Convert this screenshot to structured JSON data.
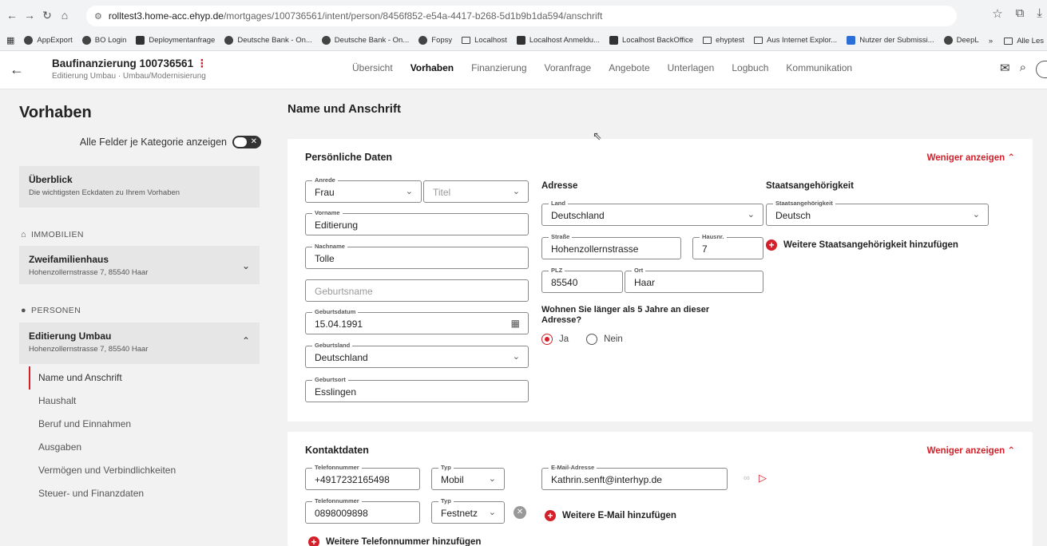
{
  "browser": {
    "url_host": "rolltest3.home-acc.ehyp.de",
    "url_path": "/mortgages/100736561/intent/person/8456f852-e54a-4417-b268-5d1b9b1da594/anschrift",
    "bookmarks": [
      "AppExport",
      "BO Login",
      "Deploymentanfrage",
      "Deutsche Bank - On...",
      "Deutsche Bank - On...",
      "Fopsy",
      "Localhost",
      "Localhost Anmeldu...",
      "Localhost BackOffice",
      "ehyptest",
      "Aus Internet Explor...",
      "Nutzer der Submissi...",
      "DeepL"
    ],
    "bookmarks_more": "»",
    "bookmarks_all": "Alle Les"
  },
  "header": {
    "title": "Baufinanzierung 100736561",
    "subtitle": "Editierung Umbau · Umbau/Modernisierung",
    "tabs": [
      "Übersicht",
      "Vorhaben",
      "Finanzierung",
      "Voranfrage",
      "Angebote",
      "Unterlagen",
      "Logbuch",
      "Kommunikation"
    ],
    "active_tab": "Vorhaben"
  },
  "sidebar": {
    "title": "Vorhaben",
    "toggle_label": "Alle Felder je Kategorie anzeigen",
    "overview": {
      "title": "Überblick",
      "subtitle": "Die wichtigsten Eckdaten zu Ihrem Vorhaben"
    },
    "immobilien_label": "IMMOBILIEN",
    "property": {
      "title": "Zweifamilienhaus",
      "subtitle": "Hohenzollernstrasse 7, 85540 Haar"
    },
    "personen_label": "PERSONEN",
    "person": {
      "title": "Editierung Umbau",
      "subtitle": "Hohenzollernstrasse 7, 85540 Haar"
    },
    "sub_items": [
      "Name und Anschrift",
      "Haushalt",
      "Beruf und Einnahmen",
      "Ausgaben",
      "Vermögen und Verbindlichkeiten",
      "Steuer- und Finanzdaten"
    ]
  },
  "main": {
    "page_title": "Name und Anschrift",
    "personal": {
      "title": "Persönliche Daten",
      "less": "Weniger anzeigen",
      "anrede": {
        "label": "Anrede",
        "value": "Frau"
      },
      "titel": {
        "placeholder": "Titel"
      },
      "vorname": {
        "label": "Vorname",
        "value": "Editierung"
      },
      "nachname": {
        "label": "Nachname",
        "value": "Tolle"
      },
      "geburtsname": {
        "placeholder": "Geburtsname"
      },
      "geburtsdatum": {
        "label": "Geburtsdatum",
        "value": "15.04.1991"
      },
      "geburtsland": {
        "label": "Geburtsland",
        "value": "Deutschland"
      },
      "geburtsort": {
        "label": "Geburtsort",
        "value": "Esslingen"
      }
    },
    "address": {
      "heading": "Adresse",
      "land": {
        "label": "Land",
        "value": "Deutschland"
      },
      "strasse": {
        "label": "Straße",
        "value": "Hohenzollernstrasse"
      },
      "hausnr": {
        "label": "Hausnr.",
        "value": "7"
      },
      "plz": {
        "label": "PLZ",
        "value": "85540"
      },
      "ort": {
        "label": "Ort",
        "value": "Haar"
      },
      "question": "Wohnen Sie länger als 5 Jahre an dieser Adresse?",
      "yes": "Ja",
      "no": "Nein"
    },
    "nationality": {
      "heading": "Staatsangehörigkeit",
      "field": {
        "label": "Staatsangehörigkeit",
        "value": "Deutsch"
      },
      "add": "Weitere Staatsangehörigkeit hinzufügen"
    },
    "contact": {
      "title": "Kontaktdaten",
      "less": "Weniger anzeigen",
      "phone1": {
        "label": "Telefonnummer",
        "value": "+4917232165498"
      },
      "type1": {
        "label": "Typ",
        "value": "Mobil"
      },
      "phone2": {
        "label": "Telefonnummer",
        "value": "0898009898"
      },
      "type2": {
        "label": "Typ",
        "value": "Festnetz"
      },
      "email": {
        "label": "E-Mail-Adresse",
        "value": "Kathrin.senft@interhyp.de"
      },
      "add_email": "Weitere E-Mail hinzufügen",
      "add_phone": "Weitere Telefonnummer hinzufügen"
    }
  },
  "colors": {
    "accent": "#d4202a",
    "background": "#f2f2f2",
    "panel": "#ffffff"
  }
}
